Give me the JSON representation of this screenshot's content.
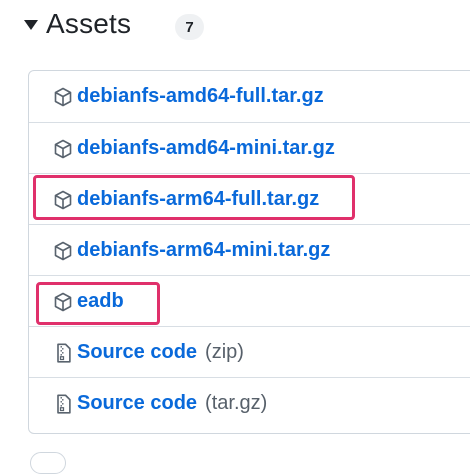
{
  "header": {
    "title": "Assets",
    "count": "7"
  },
  "assets": [
    {
      "label": "debianfs-amd64-full.tar.gz",
      "icon": "package-icon"
    },
    {
      "label": "debianfs-amd64-mini.tar.gz",
      "icon": "package-icon"
    },
    {
      "label": "debianfs-arm64-full.tar.gz",
      "icon": "package-icon"
    },
    {
      "label": "debianfs-arm64-mini.tar.gz",
      "icon": "package-icon"
    },
    {
      "label": "eadb",
      "icon": "package-icon"
    },
    {
      "label": "Source code",
      "ext": "(zip)",
      "icon": "file-zip-icon"
    },
    {
      "label": "Source code",
      "ext": "(tar.gz)",
      "icon": "file-zip-icon"
    }
  ],
  "colors": {
    "link": "#0969da",
    "highlight": "#e0306b",
    "border": "#d0d7de"
  }
}
